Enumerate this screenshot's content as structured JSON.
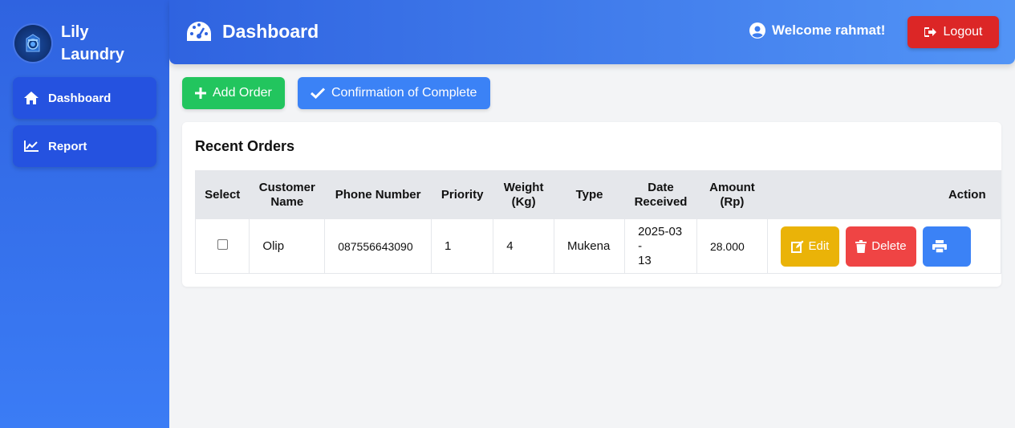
{
  "brand": {
    "name": "Lily Laundry",
    "logo_icon": "washer-logo-icon"
  },
  "sidebar": {
    "items": [
      {
        "label": "Dashboard",
        "icon": "home-icon"
      },
      {
        "label": "Report",
        "icon": "chart-line-icon"
      }
    ]
  },
  "header": {
    "title": "Dashboard",
    "title_icon": "gauge-icon",
    "welcome": "Welcome rahmat!",
    "welcome_icon": "user-circle-icon",
    "logout_label": "Logout"
  },
  "toolbar": {
    "add_label": "Add Order",
    "confirm_label": "Confirmation of Complete"
  },
  "orders": {
    "title": "Recent Orders",
    "columns": [
      "Select",
      "Customer Name",
      "Phone Number",
      "Priority",
      "Weight (Kg)",
      "Type",
      "Date Received",
      "Amount (Rp)",
      "Action"
    ],
    "rows": [
      {
        "customer": "Olip",
        "phone": "087556643090",
        "priority": "1",
        "weight": "4",
        "type": "Mukena",
        "date_line1": "2025-03",
        "date_line2": "-",
        "date_line3": "13",
        "amount": "28.000",
        "edit_label": "Edit",
        "delete_label": "Delete",
        "print_label": "Print"
      }
    ]
  },
  "colors": {
    "sidebar": "#2f63e0",
    "add": "#22c55e",
    "confirm": "#3b82f6",
    "logout": "#dc2626",
    "edit": "#eab308",
    "delete": "#ef4444"
  }
}
